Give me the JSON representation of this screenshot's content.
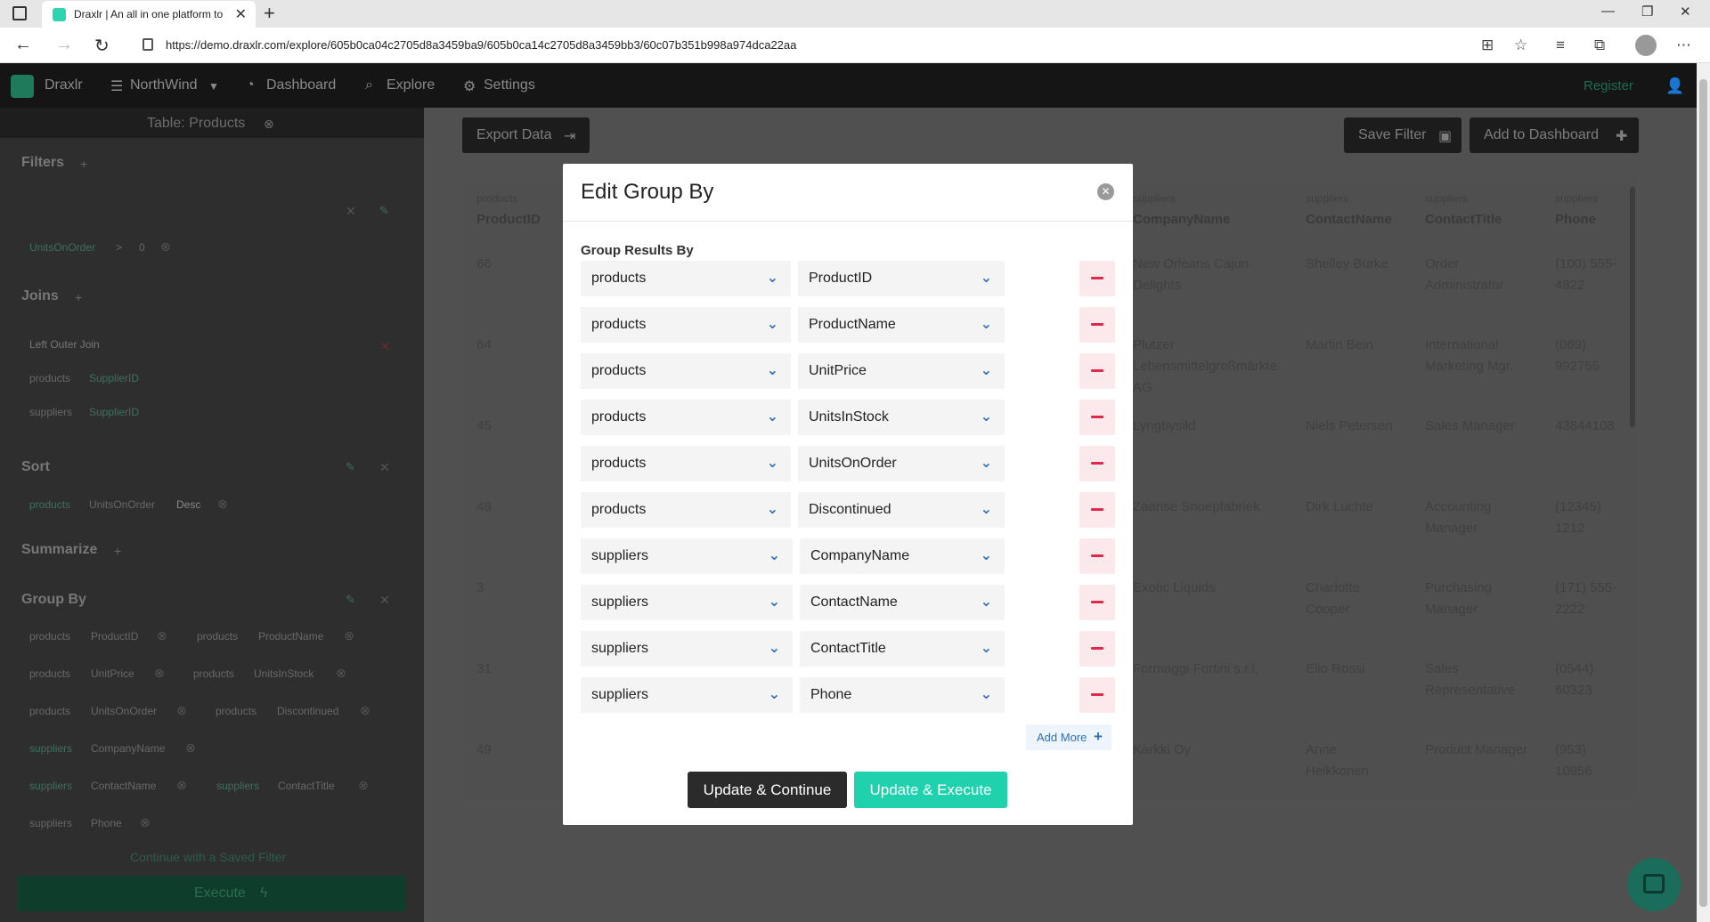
{
  "browser": {
    "tab_title": "Draxlr | An all in one platform to",
    "tab_close": "✕",
    "new_tab": "+",
    "url": "https://demo.draxlr.com/explore/605b0ca04c2705d8a3459ba9/605b0ca14c2705d8a3459bb3/60c07b351b998a974dca22aa"
  },
  "navbar": {
    "brand": "Draxlr",
    "database": "NorthWind",
    "dashboard": "Dashboard",
    "explore": "Explore",
    "settings": "Settings",
    "register": "Register"
  },
  "sidebar": {
    "table_title": "Table: Products",
    "filters_title": "Filters",
    "filter_chip_field": "UnitsOnOrder",
    "filter_chip_op": ">",
    "filter_chip_value": "0",
    "joins_title": "Joins",
    "join_type": "Left Outer Join",
    "join_left_table": "products",
    "join_left_field": "SupplierID",
    "join_right_table": "suppliers",
    "join_right_field": "SupplierID",
    "sort_title": "Sort",
    "sort_table": "products",
    "sort_field": "UnitsOnOrder",
    "sort_dir": "Desc",
    "summarize_title": "Summarize",
    "groupby_title": "Group By",
    "groupby_chips": [
      {
        "table": "products",
        "field": "ProductID"
      },
      {
        "table": "products",
        "field": "ProductName"
      },
      {
        "table": "products",
        "field": "UnitPrice"
      },
      {
        "table": "products",
        "field": "UnitsInStock"
      },
      {
        "table": "products",
        "field": "UnitsOnOrder"
      },
      {
        "table": "products",
        "field": "Discontinued"
      },
      {
        "table": "suppliers",
        "field": "CompanyName"
      },
      {
        "table": "suppliers",
        "field": "ContactName"
      },
      {
        "table": "suppliers",
        "field": "ContactTitle"
      },
      {
        "table": "suppliers",
        "field": "Phone"
      }
    ],
    "saved_filter_link": "Continue with a Saved Filter",
    "execute_label": "Execute"
  },
  "toolbar": {
    "export_label": "Export Data",
    "save_filter_label": "Save Filter",
    "add_dashboard_label": "Add to Dashboard"
  },
  "table": {
    "columns": [
      {
        "table": "products",
        "name": "ProductID"
      },
      {
        "table": "suppliers",
        "name": "CompanyName"
      },
      {
        "table": "suppliers",
        "name": "ContactName"
      },
      {
        "table": "suppliers",
        "name": "ContactTitle"
      },
      {
        "table": "suppliers",
        "name": "Phone"
      }
    ],
    "rows": [
      {
        "id": "66",
        "company": "New Orleans Cajun Delights",
        "contact": "Shelley Burke",
        "title": "Order Administrator",
        "phone": "(100) 555-4822"
      },
      {
        "id": "64",
        "company": "Plutzer Lebensmittelgroßmärkte AG",
        "contact": "Martin Bein",
        "title": "International Marketing Mgr.",
        "phone": "(069) 992755"
      },
      {
        "id": "45",
        "company": "Lyngbysild",
        "contact": "Niels Petersen",
        "title": "Sales Manager",
        "phone": "43844108"
      },
      {
        "id": "48",
        "company": "Zaanse Snoepfabriek",
        "contact": "Dirk Luchte",
        "title": "Accounting Manager",
        "phone": "(12345) 1212"
      },
      {
        "id": "3",
        "company": "Exotic Liquids",
        "contact": "Charlotte Cooper",
        "title": "Purchasing Manager",
        "phone": "(171) 555-2222"
      },
      {
        "id": "31",
        "company": "Formaggi Fortini s.r.l.",
        "contact": "Elio Rossi",
        "title": "Sales Representative",
        "phone": "(0544) 60323"
      },
      {
        "id": "49",
        "company": "Karkki Oy",
        "contact": "Anne Heikkonen",
        "title": "Product Manager",
        "phone": "(953) 10956"
      }
    ]
  },
  "modal": {
    "title": "Edit Group By",
    "close_glyph": "✕",
    "group_label": "Group Results By",
    "rows": [
      {
        "table": "products",
        "field": "ProductID"
      },
      {
        "table": "products",
        "field": "ProductName"
      },
      {
        "table": "products",
        "field": "UnitPrice"
      },
      {
        "table": "products",
        "field": "UnitsInStock"
      },
      {
        "table": "products",
        "field": "UnitsOnOrder"
      },
      {
        "table": "products",
        "field": "Discontinued"
      },
      {
        "table": "suppliers",
        "field": "CompanyName"
      },
      {
        "table": "suppliers",
        "field": "ContactName"
      },
      {
        "table": "suppliers",
        "field": "ContactTitle"
      },
      {
        "table": "suppliers",
        "field": "Phone"
      }
    ],
    "add_more_label": "Add More",
    "update_continue_label": "Update & Continue",
    "update_execute_label": "Update & Execute"
  },
  "colors": {
    "accent": "#1fd1ad",
    "remove_red": "#e0294d",
    "select_chevron": "#2f6fb3"
  }
}
